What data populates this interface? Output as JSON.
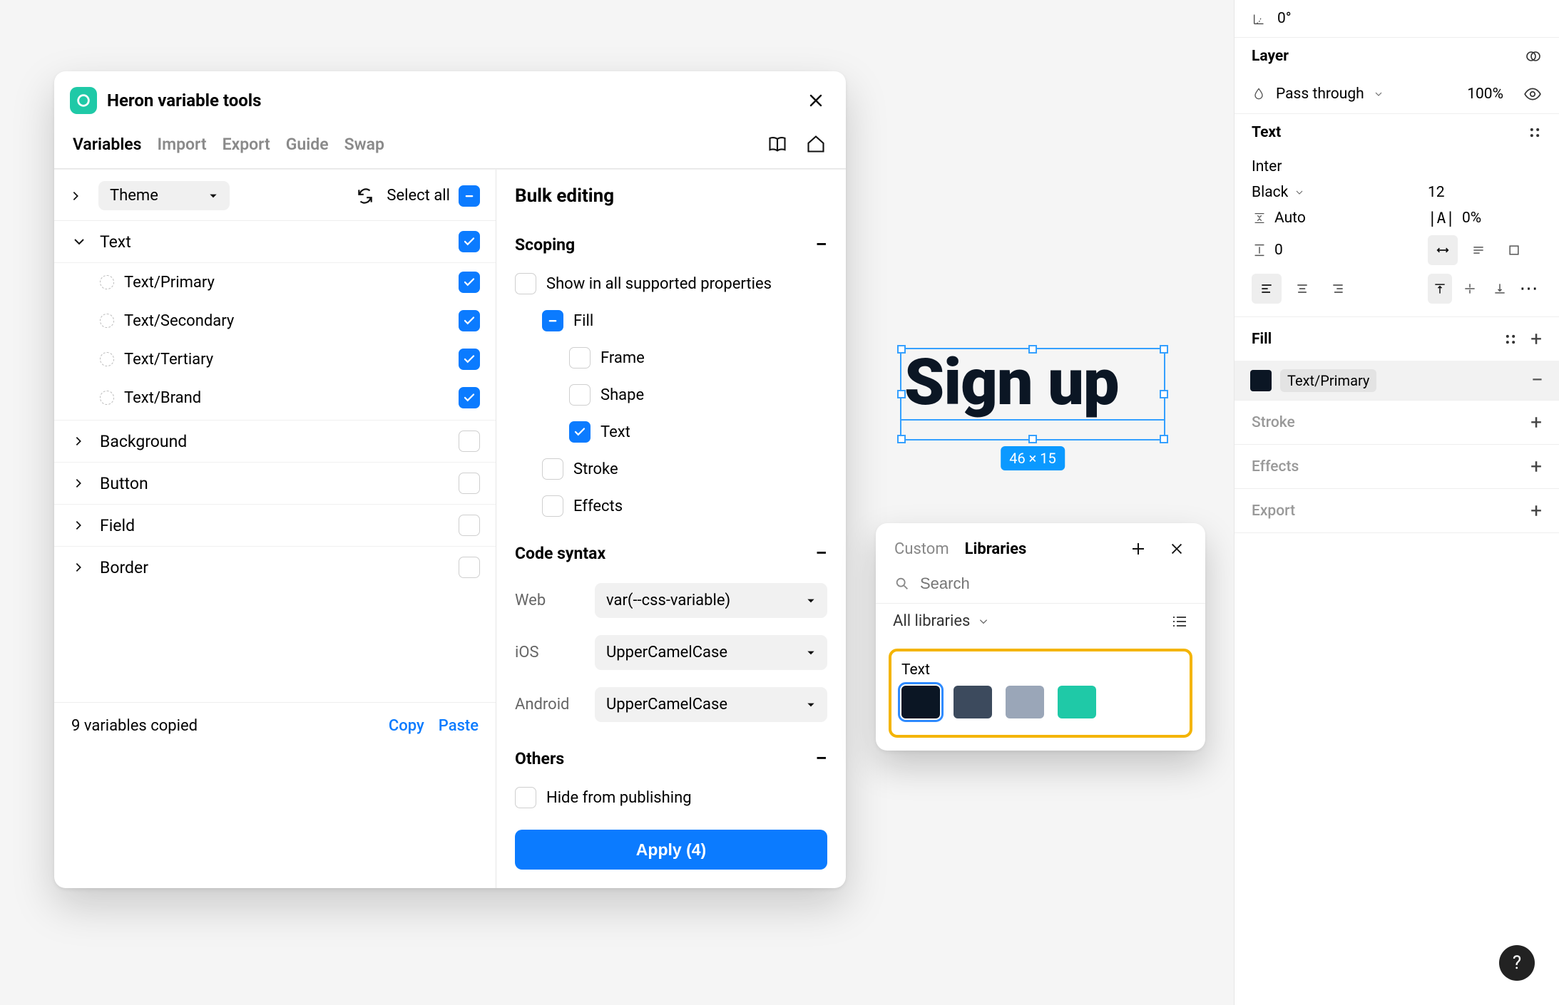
{
  "window": {
    "title": "Heron variable tools",
    "tabs": [
      "Variables",
      "Import",
      "Export",
      "Guide",
      "Swap"
    ],
    "theme_label": "Theme",
    "select_all": "Select all",
    "groups": {
      "text": {
        "label": "Text",
        "items": [
          "Text/Primary",
          "Text/Secondary",
          "Text/Tertiary",
          "Text/Brand"
        ]
      },
      "bg": {
        "label": "Background"
      },
      "button": {
        "label": "Button"
      },
      "field": {
        "label": "Field"
      },
      "border": {
        "label": "Border"
      }
    },
    "footer": {
      "status": "9 variables copied",
      "copy": "Copy",
      "paste": "Paste"
    },
    "bulk": {
      "title": "Bulk editing",
      "scoping": "Scoping",
      "show_all": "Show in all supported properties",
      "fill": "Fill",
      "frame": "Frame",
      "shape": "Shape",
      "text": "Text",
      "stroke": "Stroke",
      "effects": "Effects",
      "codesyntax": "Code syntax",
      "web": "Web",
      "ios": "iOS",
      "android": "Android",
      "web_val": "var(--css-variable)",
      "ios_val": "UpperCamelCase",
      "android_val": "UpperCamelCase",
      "others": "Others",
      "hide": "Hide from publishing",
      "apply": "Apply (4)"
    }
  },
  "canvas": {
    "text": "Sign up",
    "size": "46 × 15"
  },
  "pop": {
    "tab_custom": "Custom",
    "tab_libraries": "Libraries",
    "search_ph": "Search",
    "all_libs": "All libraries",
    "group": "Text",
    "swatches": [
      "#0b1624",
      "#3c4a5d",
      "#9aa6b8",
      "#1fc9a7"
    ]
  },
  "side": {
    "angle": "0°",
    "layer": "Layer",
    "blend": "Pass through",
    "opacity": "100%",
    "text_section": "Text",
    "font": "Inter",
    "weight": "Black",
    "size": "12",
    "lineheight": "Auto",
    "letterspacing": "0%",
    "para": "0",
    "fill": "Fill",
    "fill_label": "Text/Primary",
    "stroke": "Stroke",
    "effects": "Effects",
    "export": "Export"
  }
}
